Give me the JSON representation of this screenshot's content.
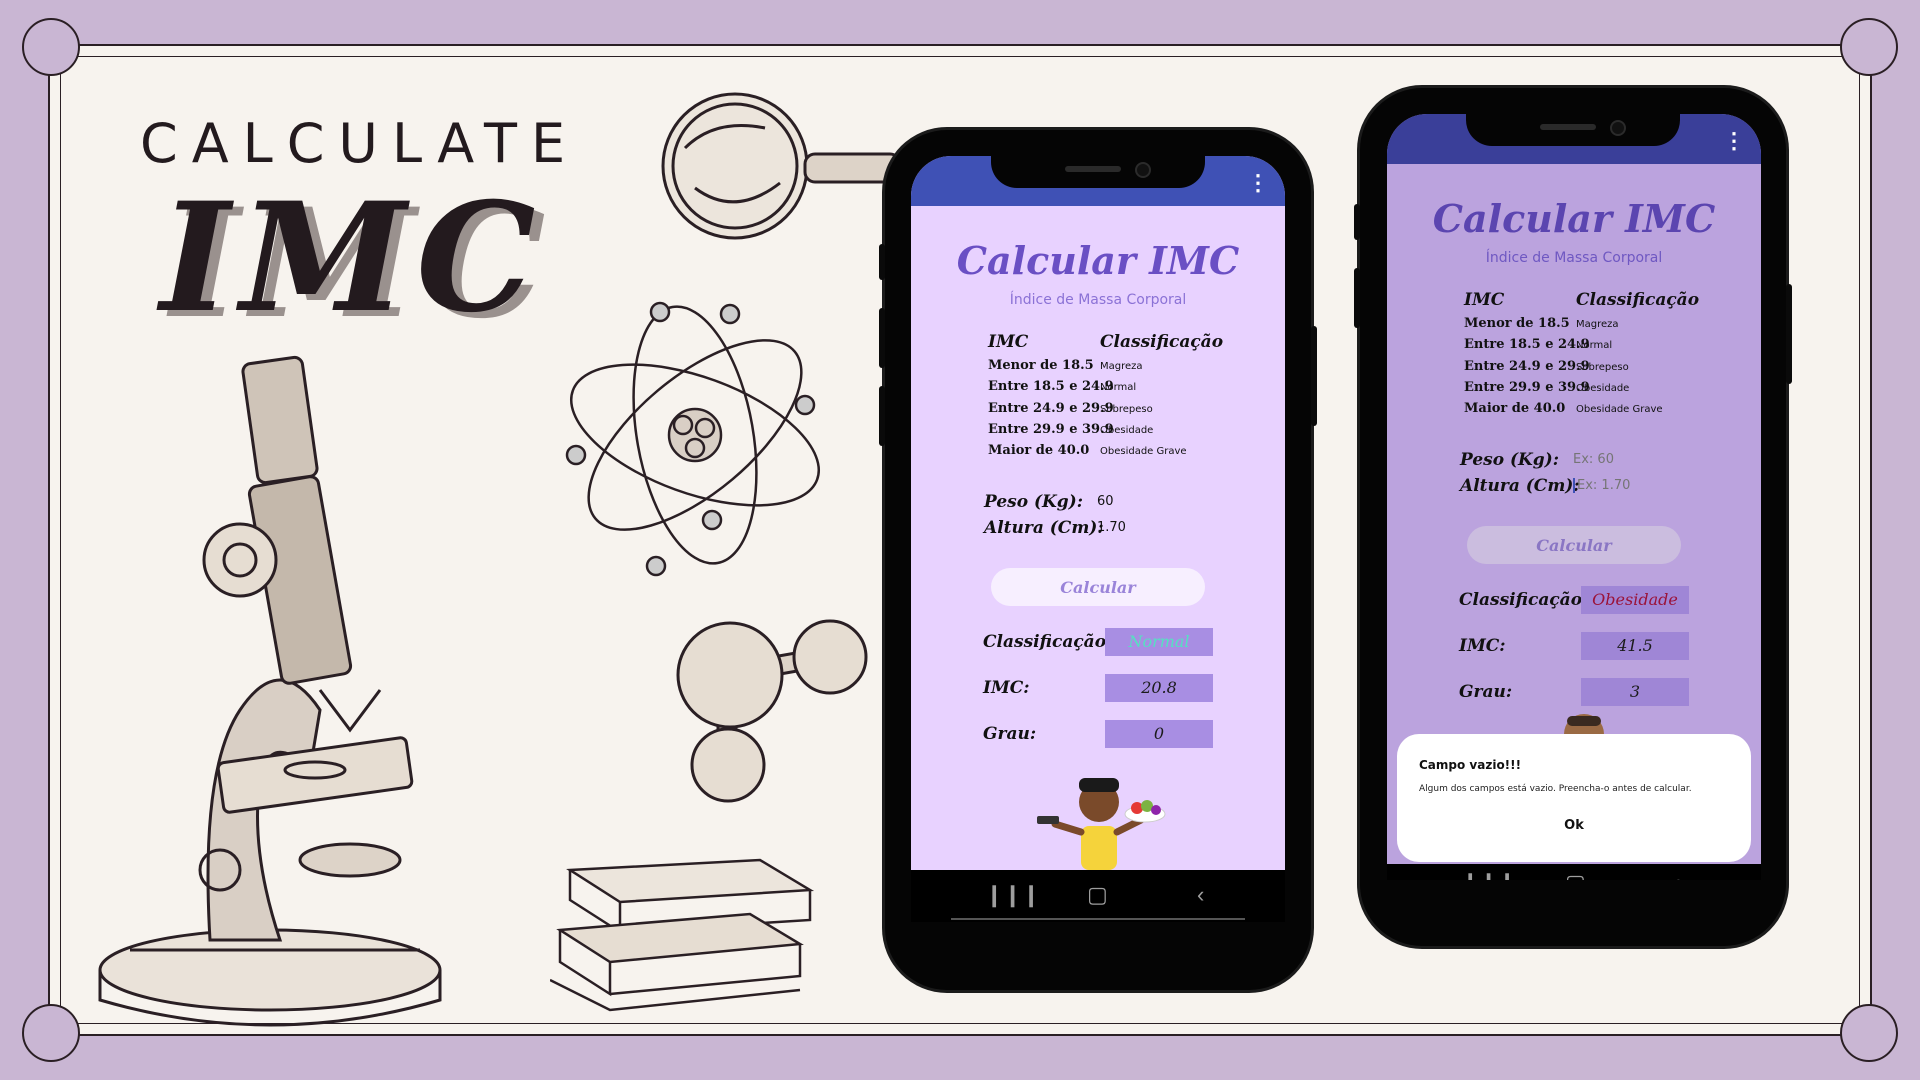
{
  "poster": {
    "title_top": "CALCULATE",
    "title_big": "IMC"
  },
  "phone1": {
    "menu_icon": "vertical-dots-icon",
    "title": "Calcular IMC",
    "subtitle": "Índice de Massa Corporal",
    "table": {
      "headers": [
        "IMC",
        "Classificação"
      ],
      "rows": [
        [
          "Menor de 18.5",
          "Magreza"
        ],
        [
          "Entre 18.5 e 24.9",
          "Normal"
        ],
        [
          "Entre 24.9 e 29.9",
          "Sobrepeso"
        ],
        [
          "Entre 29.9 e 39.9",
          "Obesidade"
        ],
        [
          "Maior de 40.0",
          "Obesidade Grave"
        ]
      ]
    },
    "peso_label": "Peso (Kg):",
    "peso_value": "60",
    "altura_label": "Altura (Cm):",
    "altura_value": "1.70",
    "button": "Calcular",
    "class_label": "Classificação:",
    "class_value": "Normal",
    "imc_label": "IMC:",
    "imc_value": "20.8",
    "grau_label": "Grau:",
    "grau_value": "0",
    "colors": {
      "class_value": "#56e0c2",
      "accent": "#6a4fc4",
      "appbar": "#3f51b5"
    }
  },
  "phone2": {
    "menu_icon": "vertical-dots-icon",
    "title": "Calcular IMC",
    "subtitle": "Índice de Massa Corporal",
    "table": {
      "headers": [
        "IMC",
        "Classificação"
      ],
      "rows": [
        [
          "Menor de 18.5",
          "Magreza"
        ],
        [
          "Entre 18.5 e 24.9",
          "Normal"
        ],
        [
          "Entre 24.9 e 29.9",
          "Sobrepeso"
        ],
        [
          "Entre 29.9 e 39.9",
          "Obesidade"
        ],
        [
          "Maior de 40.0",
          "Obesidade Grave"
        ]
      ]
    },
    "peso_label": "Peso (Kg):",
    "peso_placeholder": "Ex: 60",
    "altura_label": "Altura (Cm):",
    "altura_placeholder": "Ex: 1.70",
    "button": "Calcular",
    "class_label": "Classificação:",
    "class_value": "Obesidade",
    "imc_label": "IMC:",
    "imc_value": "41.5",
    "grau_label": "Grau:",
    "grau_value": "3",
    "dialog": {
      "title": "Campo vazio!!!",
      "message": "Algum dos campos está vazio. Preencha-o antes de calcular.",
      "ok": "Ok"
    },
    "colors": {
      "class_value": "#9b1238",
      "screen_dim": "#bba3de"
    }
  },
  "navbar": {
    "recent_icon": "recent-apps-icon",
    "home_icon": "home-icon",
    "back_icon": "back-chevron-icon"
  }
}
